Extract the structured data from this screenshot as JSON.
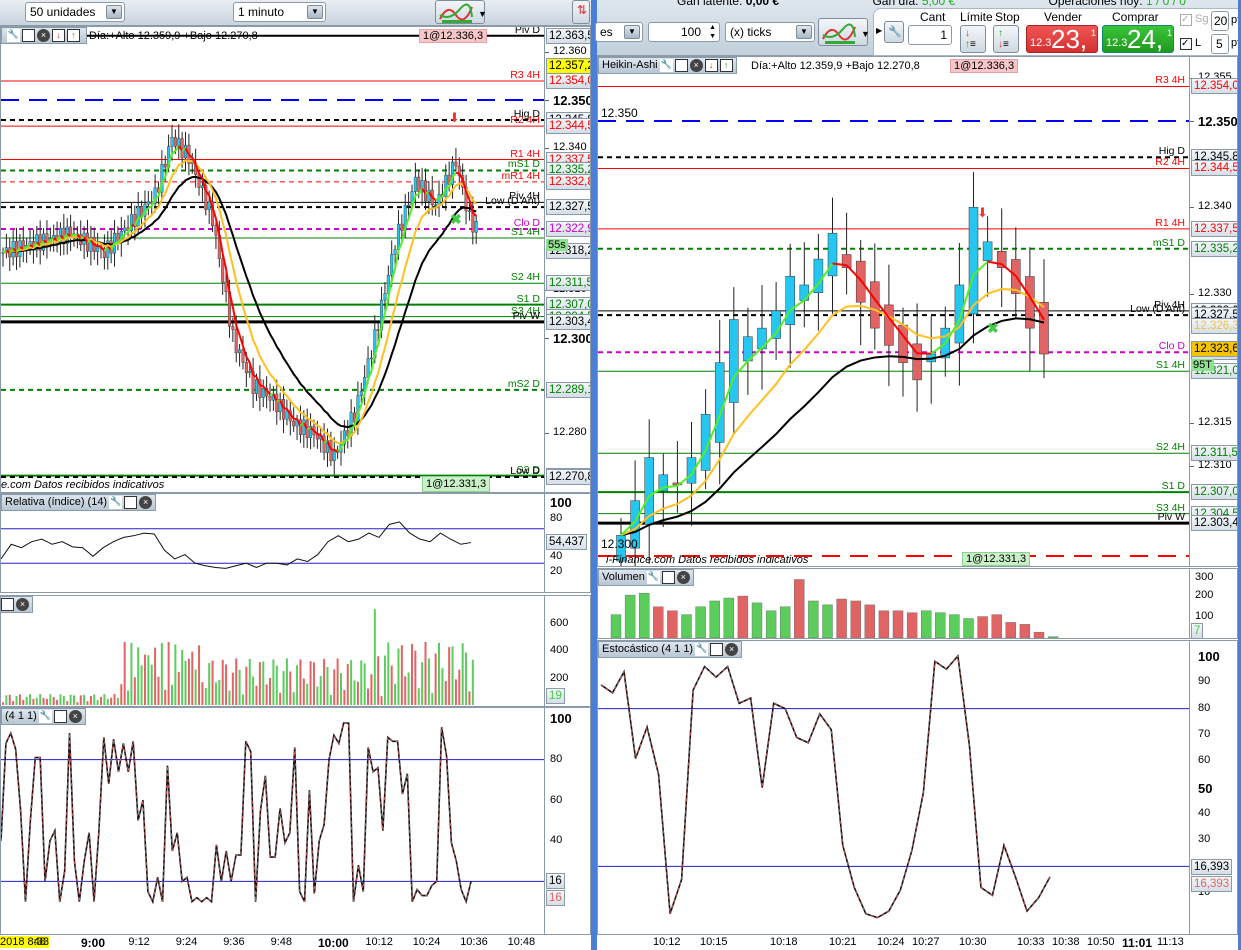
{
  "colors": {
    "up": "#25c6ef",
    "down": "#e06464",
    "vol_up": "#5ccc5c",
    "vol_down": "#e06464",
    "pivot_red": "#ff0000",
    "pivot_green": "#008000",
    "accent": "#4a7fd6"
  },
  "left": {
    "toolbar": {
      "units": "50 unidades",
      "interval": "1 minuto",
      "chart_type_icon": "chart-indicators-icon"
    },
    "chart": {
      "header_text": "Día:+Alto 12.359,9 +Bajo 12.270,8",
      "order_badge": "1@12.336,3",
      "position_badge": "1@12.331,3",
      "footer": "e.com  Datos recibidos indicativos",
      "axis_ticks": [
        {
          "p": 12.36,
          "t": "12.360"
        },
        {
          "p": 12.35,
          "t": "12.350",
          "bold": true
        },
        {
          "p": 12.34,
          "t": "12.340"
        },
        {
          "p": 12.31,
          "t": "12.310"
        },
        {
          "p": 12.3,
          "t": "12.300",
          "bold": true
        },
        {
          "p": 12.28,
          "t": "12.280"
        }
      ],
      "levels": [
        {
          "p": 12.3635,
          "label": "Piv D",
          "box": "12.363,5",
          "color": "#000",
          "style": "solid",
          "w": 2
        },
        {
          "p": 12.354,
          "label": "R3 4H",
          "box": "12.354,0",
          "color": "#ff0000",
          "style": "solid",
          "w": 1
        },
        {
          "p": 12.35,
          "label": "",
          "box": "",
          "color": "#0000ff",
          "style": "dash",
          "w": 2
        },
        {
          "p": 12.3458,
          "label": "Hig D",
          "box": "12.345,8",
          "color": "#000",
          "style": "dash",
          "w": 2
        },
        {
          "p": 12.3445,
          "label": "R2 4H",
          "box": "12.344,5",
          "color": "#ff0000",
          "style": "solid",
          "w": 1
        },
        {
          "p": 12.3375,
          "label": "R1 4H",
          "box": "12.337,5",
          "color": "#ff0000",
          "style": "solid",
          "w": 1
        },
        {
          "p": 12.3352,
          "label": "mS1 D",
          "box": "12.335,2",
          "color": "#008000",
          "style": "dash",
          "w": 2
        },
        {
          "p": 12.3328,
          "label": "mR1 4H",
          "box": "12.332,8",
          "color": "#ff0000",
          "style": "dash",
          "w": 1
        },
        {
          "p": 12.3285,
          "label": "Piv 4H",
          "box": "",
          "color": "#000",
          "style": "solid",
          "w": 1
        },
        {
          "p": 12.3275,
          "label": "Low (D Ant)",
          "box": "12.327,5",
          "color": "#000",
          "style": "dash",
          "w": 2
        },
        {
          "p": 12.3229,
          "label": "Clo D",
          "box": "12.322,9",
          "color": "#cc00cc",
          "style": "dash",
          "w": 2
        },
        {
          "p": 12.321,
          "label": "S1 4H",
          "box": "",
          "color": "#008000",
          "style": "solid",
          "w": 1
        },
        {
          "p": 12.3115,
          "label": "S2 4H",
          "box": "12.311,5",
          "color": "#008000",
          "style": "solid",
          "w": 1
        },
        {
          "p": 12.307,
          "label": "S1 D",
          "box": "12.307,0",
          "color": "#008000",
          "style": "solid",
          "w": 2
        },
        {
          "p": 12.3045,
          "label": "S3 4H",
          "box": "12.304,5",
          "color": "#008000",
          "style": "solid",
          "w": 1
        },
        {
          "p": 12.3034,
          "label": "Piv W",
          "box": "12.303,4",
          "color": "#000",
          "style": "solid",
          "w": 3
        },
        {
          "p": 12.2891,
          "label": "mS2 D",
          "box": "12.289,1",
          "color": "#008000",
          "style": "dash",
          "w": 2
        },
        {
          "p": 12.2711,
          "label": "S2 D",
          "box": "12.271,1",
          "color": "#008000",
          "style": "solid",
          "w": 2
        },
        {
          "p": 12.2708,
          "label": "Low D",
          "box": "12.270,8",
          "color": "#000",
          "style": "dash",
          "w": 2
        }
      ],
      "extra_boxes": [
        {
          "p": 12.3572,
          "t": "12.357,2",
          "bg": "#ffff00"
        },
        {
          "p": 12.3182,
          "t": "12.318,2",
          "bg": ""
        }
      ],
      "timer_badge": "55s",
      "price_path": [
        [
          0,
          12.318
        ],
        [
          20,
          12.322
        ],
        [
          30,
          12.318
        ],
        [
          45,
          12.33
        ],
        [
          50,
          12.342
        ],
        [
          55,
          12.338
        ],
        [
          62,
          12.325
        ],
        [
          68,
          12.3
        ],
        [
          74,
          12.29
        ],
        [
          80,
          12.287
        ],
        [
          86,
          12.282
        ],
        [
          92,
          12.28
        ],
        [
          98,
          12.275
        ],
        [
          104,
          12.284
        ],
        [
          110,
          12.3
        ],
        [
          116,
          12.32
        ],
        [
          122,
          12.333
        ],
        [
          128,
          12.328
        ],
        [
          134,
          12.337
        ],
        [
          138,
          12.325
        ],
        [
          140,
          12.323
        ]
      ]
    },
    "rsi": {
      "title": "Relativa (índice) (14)",
      "value": "54,437",
      "ticks": [
        "100",
        "80",
        "40",
        "20"
      ],
      "values": [
        35,
        52,
        48,
        55,
        58,
        52,
        55,
        49,
        48,
        38,
        48,
        55,
        60,
        62,
        65,
        64,
        45,
        35,
        40,
        30,
        27,
        25,
        24,
        27,
        30,
        25,
        30,
        30,
        28,
        35,
        32,
        40,
        55,
        62,
        55,
        58,
        65,
        60,
        75,
        78,
        65,
        58,
        55,
        65,
        58,
        52,
        54
      ]
    },
    "volume": {
      "value": "19",
      "ticks": [
        "600",
        "400",
        "200"
      ]
    },
    "stoch": {
      "title": "(4 1 1)",
      "value_k": "16",
      "value_d": "16",
      "ticks": [
        "100",
        "80",
        "60",
        "40"
      ],
      "values": [
        40,
        88,
        93,
        85,
        55,
        10,
        50,
        81,
        81,
        20,
        40,
        45,
        10,
        25,
        93,
        30,
        10,
        30,
        44,
        10,
        45,
        91,
        68,
        90,
        74,
        88,
        74,
        89,
        50,
        60,
        15,
        10,
        22,
        10,
        77,
        35,
        44,
        20,
        22,
        10,
        12,
        10,
        12,
        10,
        38,
        20,
        35,
        20,
        33,
        33,
        89,
        84,
        10,
        55,
        72,
        32,
        32,
        56,
        39,
        44,
        86,
        15,
        10,
        65,
        14,
        40,
        48,
        80,
        92,
        88,
        98,
        98,
        10,
        28,
        15,
        86,
        74,
        76,
        45,
        91,
        89,
        89,
        63,
        73,
        10,
        16,
        13,
        13,
        18,
        20,
        96,
        82,
        39,
        30,
        16,
        10,
        20
      ]
    },
    "time_axis": [
      {
        "m": 513,
        "t": "2018 8:33",
        "hl": true
      },
      {
        "m": 528,
        "t": "48"
      },
      {
        "m": 540,
        "t": "9:00",
        "bold": true
      },
      {
        "m": 552,
        "t": "9:12"
      },
      {
        "m": 564,
        "t": "9:24"
      },
      {
        "m": 576,
        "t": "9:36"
      },
      {
        "m": 588,
        "t": "9:48"
      },
      {
        "m": 600,
        "t": "10:00",
        "bold": true
      },
      {
        "m": 612,
        "t": "10:12"
      },
      {
        "m": 624,
        "t": "10:24"
      },
      {
        "m": 636,
        "t": "10:36"
      },
      {
        "m": 648,
        "t": "10:48"
      }
    ]
  },
  "right": {
    "status": {
      "gan_latente": "Gan latente:",
      "gan_latente_val": "0,00 €",
      "gan_dia": "Gan día:",
      "gan_dia_val": "5,00 €",
      "operaciones": "Operaciones hoy:",
      "operaciones_val": "1 / 0 / 0"
    },
    "toolbar": {
      "range_select": "es",
      "quantity": "100",
      "unit_select": "(x) ticks"
    },
    "order": {
      "cant_label": "Cant",
      "cant_value": "1",
      "limite_label": "Límite",
      "stop_label": "Stop",
      "vender_label": "Vender",
      "vender_small": "12.3",
      "vender_big": "23,",
      "vender_sup": "1",
      "comprar_label": "Comprar",
      "comprar_small": "12.3",
      "comprar_big": "24,",
      "comprar_sup": "1",
      "sg_label": "Sg",
      "sg_pts": "20",
      "l_label": "L",
      "l_pts": "5",
      "pts": "pts"
    },
    "chart": {
      "title": "Heikin-Ashi",
      "header_text": "Día:+Alto 12.359,9 +Bajo 12.270,8",
      "order_badge": "1@12.336,3",
      "position_badge": "1@12.331,3",
      "footer": "l-Finance.com  Datos recibidos indicativos",
      "overlay_top": "12.350",
      "overlay_bottom": "12.300",
      "axis_ticks": [
        {
          "p": 12.355,
          "t": "12.355"
        },
        {
          "p": 12.35,
          "t": "12.350",
          "bold": true
        },
        {
          "p": 12.34,
          "t": "12.340"
        },
        {
          "p": 12.33,
          "t": "12.330"
        },
        {
          "p": 12.315,
          "t": "12.315"
        },
        {
          "p": 12.31,
          "t": "12.310"
        }
      ],
      "levels": [
        {
          "p": 12.354,
          "label": "R3 4H",
          "box": "12.354,0",
          "color": "#ff0000",
          "style": "solid",
          "w": 1
        },
        {
          "p": 12.35,
          "label": "",
          "box": "",
          "color": "#0000ff",
          "style": "dash",
          "w": 2
        },
        {
          "p": 12.3458,
          "label": "Hig D",
          "box": "12.345,8",
          "color": "#000",
          "style": "dash",
          "w": 2
        },
        {
          "p": 12.3445,
          "label": "R2 4H",
          "box": "12.344,5",
          "color": "#ff0000",
          "style": "solid",
          "w": 1
        },
        {
          "p": 12.3375,
          "label": "R1 4H",
          "box": "12.337,5",
          "color": "#ff0000",
          "style": "solid",
          "w": 1
        },
        {
          "p": 12.3352,
          "label": "mS1 D",
          "box": "12.335,2",
          "color": "#008000",
          "style": "dash",
          "w": 2
        },
        {
          "p": 12.328,
          "label": "Piv 4H",
          "box": "12.328,0",
          "color": "#000",
          "style": "solid",
          "w": 1
        },
        {
          "p": 12.3275,
          "label": "Low (D Ant)",
          "box": "12.327,5",
          "color": "#000",
          "style": "dash",
          "w": 2
        },
        {
          "p": 12.3232,
          "label": "Clo D",
          "box": "12.323,2",
          "color": "#cc00cc",
          "style": "dash",
          "w": 2
        },
        {
          "p": 12.321,
          "label": "S1 4H",
          "box": "12.321,0",
          "color": "#008000",
          "style": "solid",
          "w": 1
        },
        {
          "p": 12.3115,
          "label": "S2 4H",
          "box": "12.311,5",
          "color": "#008000",
          "style": "solid",
          "w": 1
        },
        {
          "p": 12.307,
          "label": "S1 D",
          "box": "12.307,0",
          "color": "#008000",
          "style": "solid",
          "w": 2
        },
        {
          "p": 12.3045,
          "label": "S3 4H",
          "box": "12.304,5",
          "color": "#008000",
          "style": "solid",
          "w": 1
        },
        {
          "p": 12.3034,
          "label": "Piv W",
          "box": "12.303,4",
          "color": "#000",
          "style": "solid",
          "w": 3
        },
        {
          "p": 12.2996,
          "label": "",
          "box": "",
          "color": "#ff0000",
          "style": "dash",
          "w": 2
        }
      ],
      "extra_boxes": [
        {
          "p": 12.3263,
          "t": "12.326,3",
          "bg": "",
          "fg": "#f0c040"
        },
        {
          "p": 12.3236,
          "t": "12.323,6",
          "bg": "#f5c400"
        }
      ],
      "timer_badge": "95T",
      "closes": [
        12.302,
        12.306,
        12.311,
        12.309,
        12.308,
        12.311,
        12.316,
        12.322,
        12.327,
        12.325,
        12.326,
        12.328,
        12.332,
        12.331,
        12.334,
        12.337,
        12.333,
        12.329,
        12.326,
        12.324,
        12.322,
        12.32,
        12.323,
        12.326,
        12.331,
        12.34,
        12.336,
        12.333,
        12.33,
        12.326,
        12.323
      ]
    },
    "volume": {
      "title": "Volumen",
      "value": "7",
      "ticks": [
        "300",
        "200",
        "100"
      ],
      "values": [
        120,
        220,
        230,
        160,
        140,
        120,
        160,
        190,
        205,
        215,
        180,
        140,
        160,
        300,
        190,
        170,
        200,
        190,
        170,
        140,
        140,
        130,
        140,
        130,
        120,
        100,
        110,
        120,
        80,
        70,
        30,
        7
      ]
    },
    "stoch": {
      "title": "Estocástico (4 1 1)",
      "value_k": "16,393",
      "value_d": "16,393",
      "ticks": [
        "100",
        "90",
        "80",
        "70",
        "60",
        "50",
        "40",
        "30",
        "10"
      ],
      "values": [
        89,
        86,
        94,
        61,
        73,
        55,
        2,
        15,
        87,
        96,
        92,
        96,
        82,
        84,
        50,
        82,
        80,
        69,
        67,
        78,
        72,
        28,
        12,
        2,
        0.5,
        3,
        11,
        26,
        48,
        98,
        95,
        100,
        66,
        12,
        9,
        28,
        16,
        3,
        8,
        16
      ]
    },
    "time_axis": [
      "10:12",
      "10:15",
      "10:18",
      "10:21",
      "10:24",
      "10:27",
      "10:30",
      "10:33",
      "10:38",
      "10:50",
      "11:01",
      "11:13"
    ]
  }
}
